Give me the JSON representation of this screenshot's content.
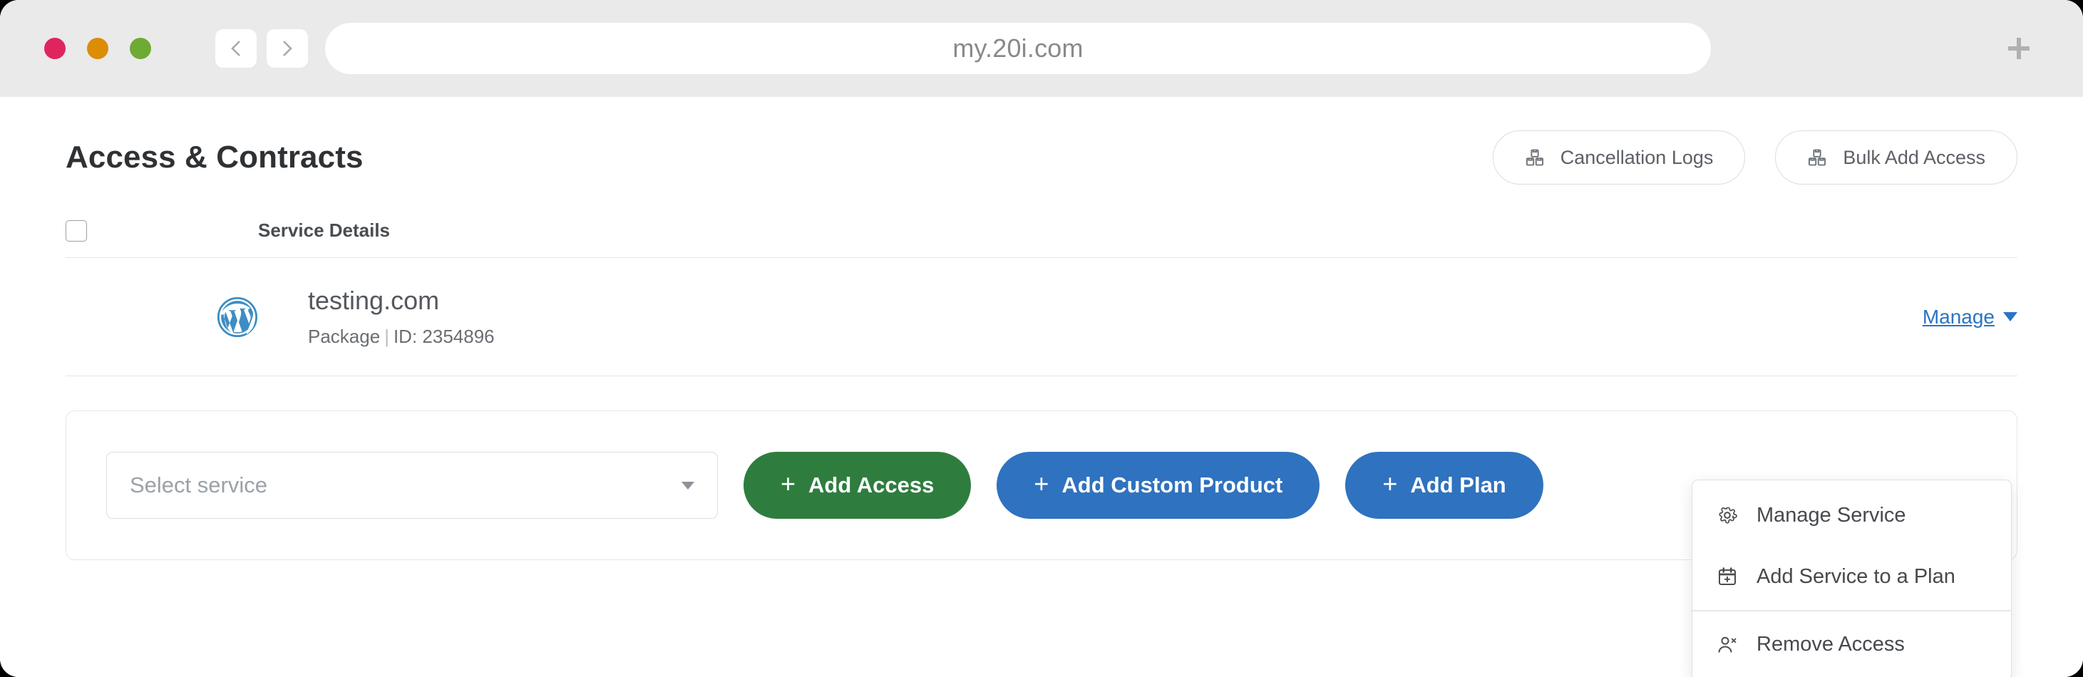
{
  "browser": {
    "url": "my.20i.com",
    "back_icon": "chevron-left-icon",
    "forward_icon": "chevron-right-icon",
    "new_tab_icon": "plus-icon",
    "traffic_lights": {
      "close_color": "#e0245e",
      "minimize_color": "#dd8c06",
      "maximize_color": "#6faa34"
    }
  },
  "page": {
    "title": "Access & Contracts",
    "header_buttons": [
      {
        "label": "Cancellation Logs",
        "icon": "boxes-icon"
      },
      {
        "label": "Bulk Add Access",
        "icon": "boxes-icon"
      }
    ],
    "table": {
      "select_all_checkbox": "unchecked",
      "columns": [
        "Service Details"
      ],
      "rows": [
        {
          "logo": "wordpress-icon",
          "service_name": "testing.com",
          "type": "Package",
          "separator": "|",
          "id_label": "ID: 2354896",
          "action_label": "Manage",
          "action_caret": "caret-down-icon"
        }
      ]
    },
    "dropdown": {
      "open": true,
      "items": [
        {
          "label": "Manage Service",
          "icon": "gear-icon"
        },
        {
          "label": "Add Service to a Plan",
          "icon": "calendar-plus-icon"
        },
        {
          "label": "Remove Access",
          "icon": "user-remove-icon"
        }
      ]
    },
    "action_bar": {
      "select_placeholder": "Select service",
      "select_caret": "caret-down-icon",
      "buttons": [
        {
          "label": "Add Access",
          "plus": "+",
          "color": "#2e7d3e"
        },
        {
          "label": "Add Custom Product",
          "plus": "+",
          "color": "#2f72bf"
        },
        {
          "label": "Add Plan",
          "plus": "+",
          "color": "#2f72bf"
        }
      ]
    }
  },
  "colors": {
    "accent_blue": "#2a74c4",
    "button_green": "#2e7d3e",
    "button_blue": "#2f72bf",
    "chrome_gray": "#eaeaea",
    "wordpress_blue": "#3d8dc4"
  }
}
